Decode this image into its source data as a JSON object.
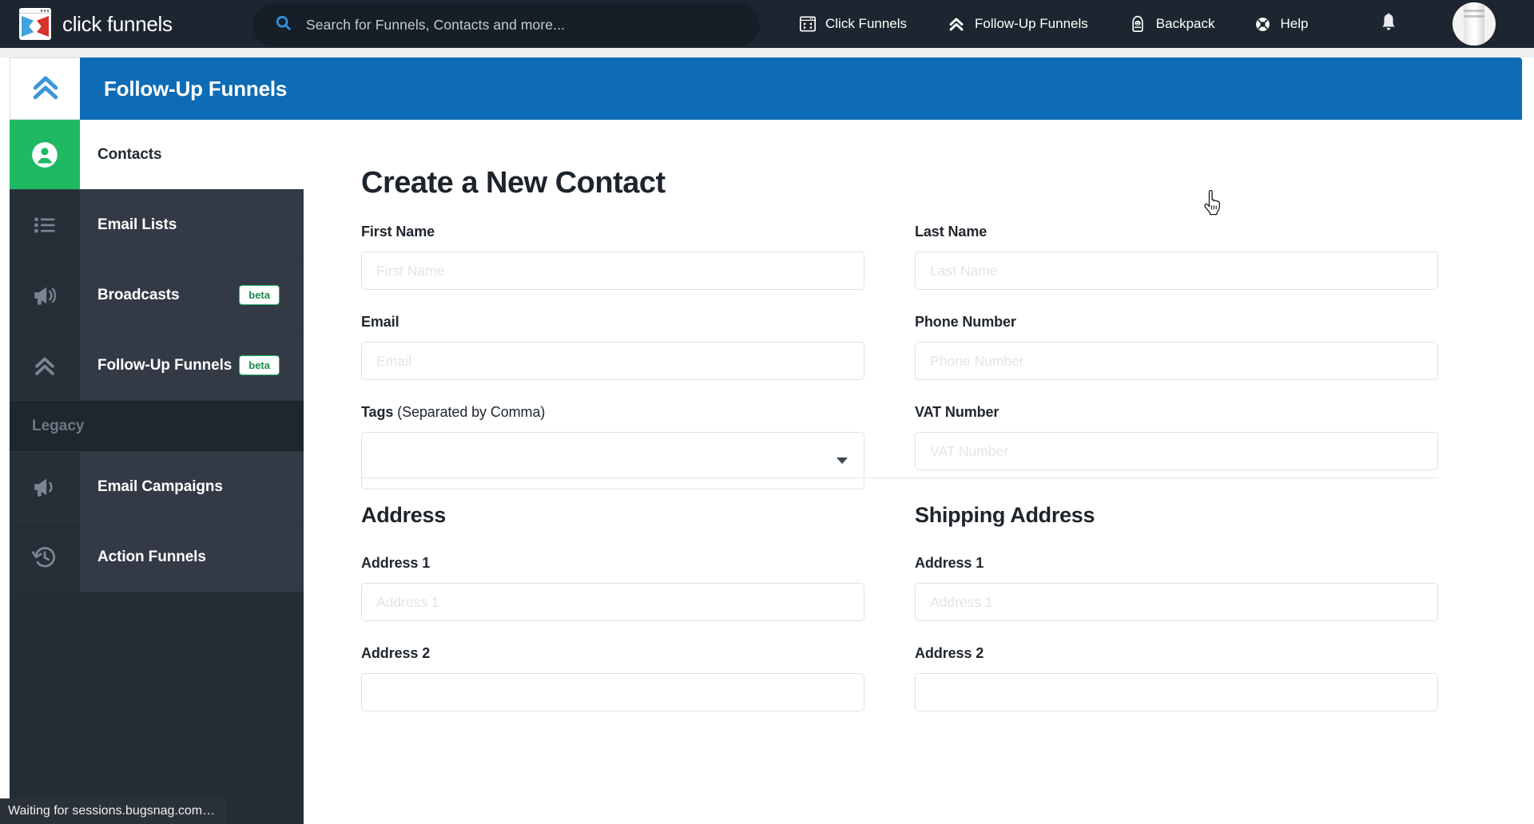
{
  "topnav": {
    "brand": "click funnels",
    "search": {
      "placeholder": "Search for Funnels, Contacts and more...",
      "value": ""
    },
    "links": [
      {
        "label": "Click Funnels",
        "icon": "click-funnels-icon"
      },
      {
        "label": "Follow-Up Funnels",
        "icon": "chevrons-up-icon"
      },
      {
        "label": "Backpack",
        "icon": "backpack-icon"
      },
      {
        "label": "Help",
        "icon": "lifebuoy-icon"
      }
    ],
    "notifications_icon": "bell-icon",
    "avatar_icon": "user-avatar"
  },
  "header": {
    "title": "Follow-Up Funnels",
    "logo_icon": "chevrons-up-icon",
    "accent_color": "#0d6cb5"
  },
  "sidebar": {
    "active_color": "#1fb964",
    "items": [
      {
        "label": "Contacts",
        "icon": "user-circle-icon",
        "badge": "",
        "active": true
      },
      {
        "label": "Email Lists",
        "icon": "list-icon",
        "badge": "",
        "active": false
      },
      {
        "label": "Broadcasts",
        "icon": "megaphone-icon",
        "badge": "beta",
        "active": false
      },
      {
        "label": "Follow-Up Funnels",
        "icon": "chevrons-up-icon",
        "badge": "beta",
        "active": false
      }
    ],
    "section_label": "Legacy",
    "legacy_items": [
      {
        "label": "Email Campaigns",
        "icon": "megaphone-icon",
        "badge": "",
        "active": false
      },
      {
        "label": "Action Funnels",
        "icon": "history-icon",
        "badge": "",
        "active": false
      }
    ]
  },
  "main": {
    "page_title": "Create a New Contact",
    "fields": {
      "first_name": {
        "label": "First Name",
        "placeholder": "First Name",
        "value": ""
      },
      "last_name": {
        "label": "Last Name",
        "placeholder": "Last Name",
        "value": ""
      },
      "email": {
        "label": "Email",
        "placeholder": "Email",
        "value": ""
      },
      "phone": {
        "label": "Phone Number",
        "placeholder": "Phone Number",
        "value": ""
      },
      "tags": {
        "label": "Tags",
        "label_sub": " (Separated by Comma)",
        "value": ""
      },
      "vat": {
        "label": "VAT Number",
        "placeholder": "VAT Number",
        "value": ""
      }
    },
    "address_section": {
      "title": "Address",
      "address1_label": "Address 1",
      "address1_placeholder": "Address 1",
      "address1_value": "",
      "address2_label": "Address 2"
    },
    "shipping_section": {
      "title": "Shipping Address",
      "address1_label": "Address 1",
      "address1_placeholder": "Address 1",
      "address1_value": "",
      "address2_label": "Address 2"
    }
  },
  "statusbar": {
    "text": "Waiting for sessions.bugsnag.com…"
  }
}
